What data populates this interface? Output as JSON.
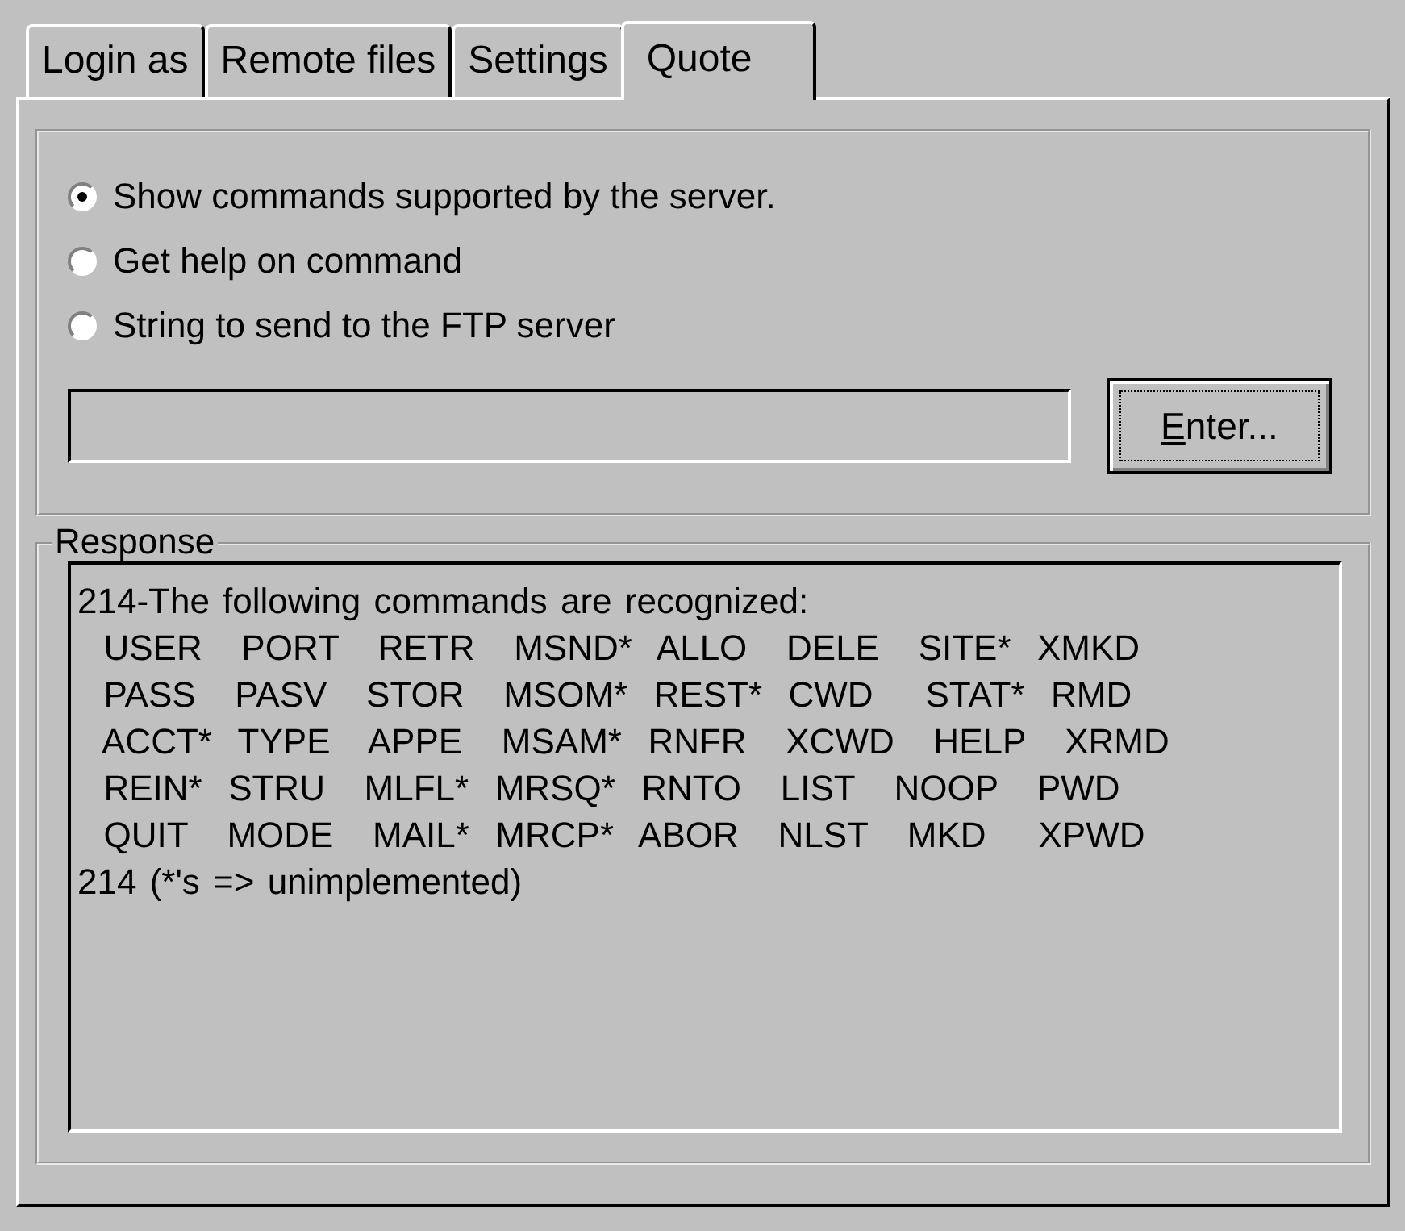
{
  "tabs": [
    {
      "label": "Login as",
      "selected": false
    },
    {
      "label": "Remote files",
      "selected": false
    },
    {
      "label": "Settings",
      "selected": false
    },
    {
      "label": "Quote",
      "selected": true
    }
  ],
  "options": [
    {
      "label": "Show commands supported by the server.",
      "selected": true
    },
    {
      "label": "Get help on command",
      "selected": false
    },
    {
      "label": "String to send to the FTP server",
      "selected": false
    }
  ],
  "enter_button": {
    "label": "Enter...",
    "focused": true
  },
  "response": {
    "title": "Response",
    "lines": [
      "214-The following commands are recognized:",
      "  USER   PORT   RETR   MSND*  ALLO   DELE   SITE*  XMKD",
      "  PASS   PASV   STOR   MSOM*  REST*  CWD    STAT*  RMD",
      "  ACCT*  TYPE   APPE   MSAM*  RNFR   XCWD   HELP   XRMD",
      "  REIN*  STRU   MLFL*  MRSQ*  RNTO   LIST   NOOP   PWD",
      "  QUIT   MODE   MAIL*  MRCP*  ABOR   NLST   MKD    XPWD",
      "214 (*'s => unimplemented)"
    ]
  }
}
